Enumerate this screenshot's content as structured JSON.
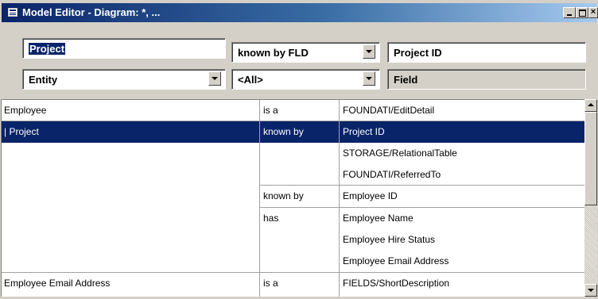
{
  "window": {
    "title": "Model Editor - Diagram: *, ...",
    "icon": "model-editor-icon"
  },
  "filters": {
    "subject": {
      "value": "Project",
      "selected": true
    },
    "relation": {
      "value": "known by FLD"
    },
    "target_value": {
      "value": "Project ID"
    },
    "subject_type": {
      "value": "Entity"
    },
    "relation_filter": {
      "value": "<All>"
    },
    "target_type": {
      "label": "Field"
    }
  },
  "grid": {
    "rows": [
      {
        "subject": "Employee",
        "relation": "is a",
        "object": "FOUNDATI/EditDetail",
        "selected": false
      },
      {
        "subject": "Project",
        "relation": "known by",
        "object": "Project ID",
        "selected": true
      },
      {
        "subject": "",
        "relation": "",
        "object": "STORAGE/RelationalTable",
        "selected": false
      },
      {
        "subject": "",
        "relation": "",
        "object": "FOUNDATI/ReferredTo",
        "selected": false
      },
      {
        "subject": "",
        "relation": "known by",
        "object": "Employee ID",
        "selected": false
      },
      {
        "subject": "",
        "relation": "has",
        "object": "Employee Name",
        "selected": false
      },
      {
        "subject": "",
        "relation": "",
        "object": "Employee Hire Status",
        "selected": false
      },
      {
        "subject": "",
        "relation": "",
        "object": "Employee Email Address",
        "selected": false
      },
      {
        "subject": "Employee Email Address",
        "relation": "is a",
        "object": "FIELDS/ShortDescription",
        "selected": false
      }
    ]
  },
  "colors": {
    "selection": "#0a246a",
    "titlebar_start": "#0a246a",
    "titlebar_end": "#a6caf0",
    "face": "#d4d0c8"
  }
}
